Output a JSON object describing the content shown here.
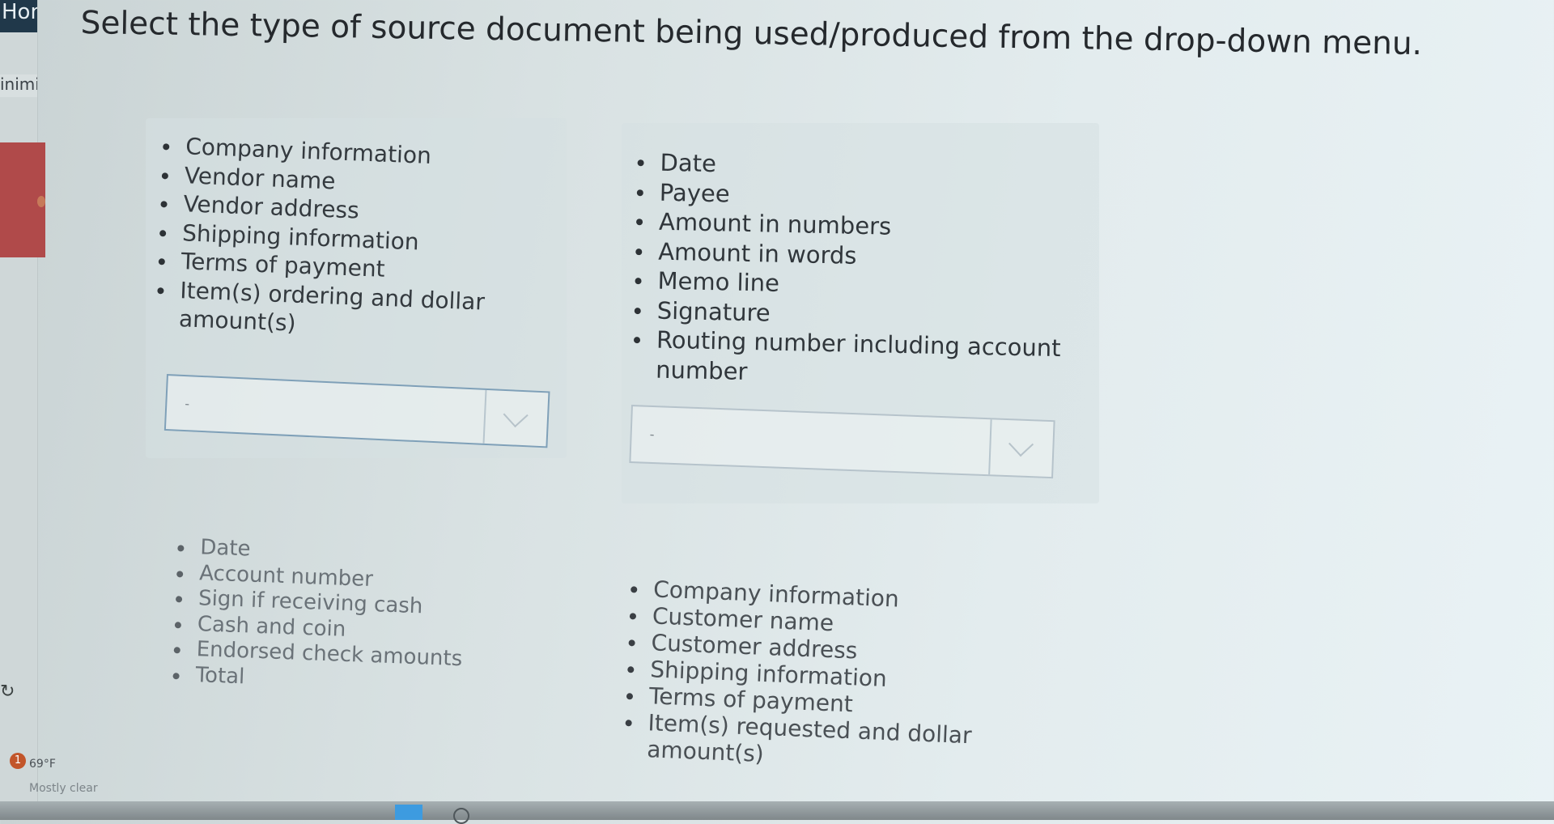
{
  "window": {
    "tab_home_label": "Hon",
    "tab_minimize_label": "inimiz"
  },
  "question": "Select the type of source document being used/produced from the drop-down menu.",
  "groups": [
    {
      "items": [
        "Company information",
        "Vendor name",
        "Vendor address",
        "Shipping information",
        "Terms of payment",
        "Item(s) ordering and dollar amount(s)"
      ],
      "item_lines": [
        [
          "Company information"
        ],
        [
          "Vendor name"
        ],
        [
          "Vendor address"
        ],
        [
          "Shipping information"
        ],
        [
          "Terms of payment"
        ],
        [
          "Item(s) ordering and dollar",
          "amount(s)"
        ]
      ],
      "dropdown_value": "-"
    },
    {
      "items": [
        "Date",
        "Payee",
        "Amount in numbers",
        "Amount in words",
        "Memo line",
        "Signature",
        "Routing number including account number"
      ],
      "item_lines": [
        [
          "Date"
        ],
        [
          "Payee"
        ],
        [
          "Amount in numbers"
        ],
        [
          "Amount in words"
        ],
        [
          "Memo line"
        ],
        [
          "Signature"
        ],
        [
          "Routing number including account",
          "number"
        ]
      ],
      "dropdown_value": "-"
    },
    {
      "items": [
        "Date",
        "Account number",
        "Sign if receiving cash",
        "Cash and coin",
        "Endorsed check amounts",
        "Total"
      ],
      "item_lines": [
        [
          "Date"
        ],
        [
          "Account number"
        ],
        [
          "Sign if receiving cash"
        ],
        [
          "Cash and coin"
        ],
        [
          "Endorsed check amounts"
        ],
        [
          "Total"
        ]
      ]
    },
    {
      "items": [
        "Company information",
        "Customer name",
        "Customer address",
        "Shipping information",
        "Terms of payment",
        "Item(s) requested and dollar amount(s)"
      ],
      "item_lines": [
        [
          "Company information"
        ],
        [
          "Customer name"
        ],
        [
          "Customer address"
        ],
        [
          "Shipping information"
        ],
        [
          "Terms of payment"
        ],
        [
          "Item(s) requested and dollar",
          "amount(s)"
        ]
      ]
    }
  ],
  "taskbar": {
    "weather_badge": "1",
    "temperature": "69°F",
    "condition": "Mostly clear"
  }
}
